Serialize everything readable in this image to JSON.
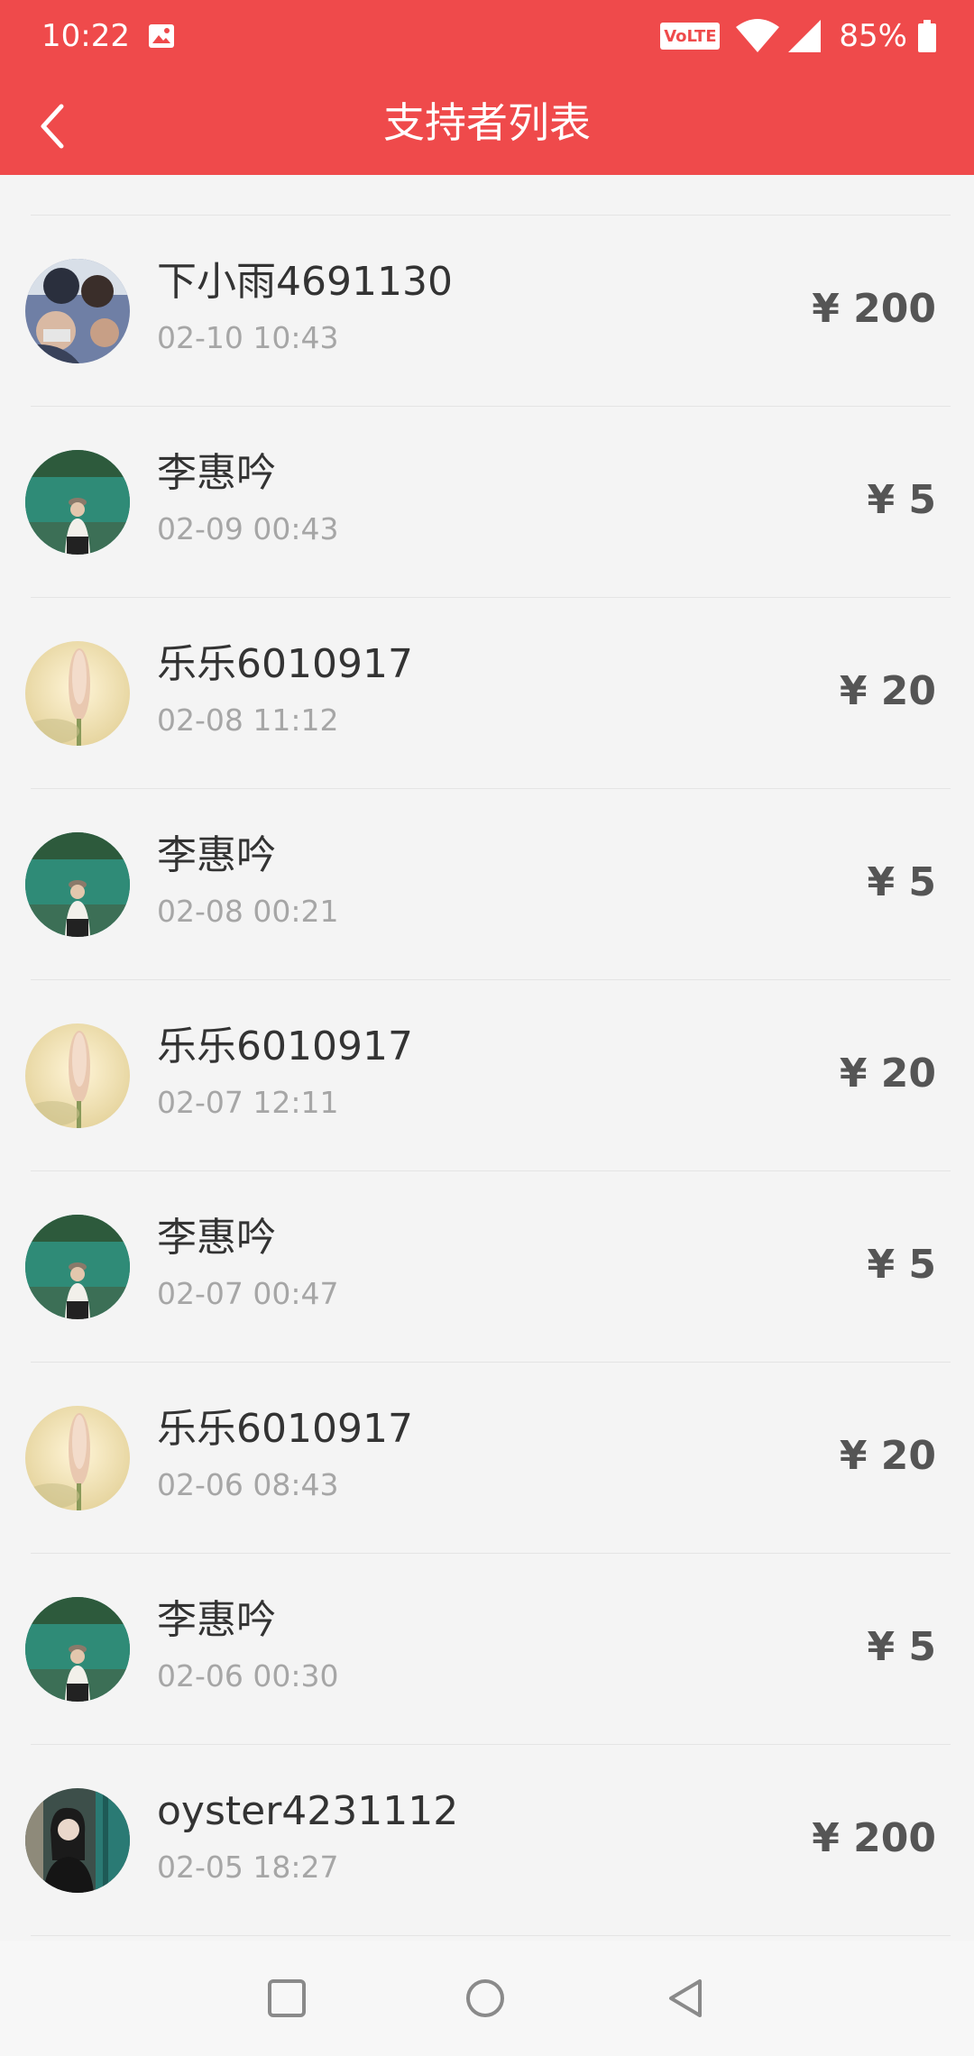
{
  "status_bar": {
    "time": "10:22",
    "network_badge": "VoLTE",
    "battery_percent": "85%",
    "icons": [
      "image-icon",
      "volte-icon",
      "wifi-icon",
      "signal-icon",
      "battery-icon"
    ]
  },
  "header": {
    "title": "支持者列表",
    "back_icon": "chevron-left-icon"
  },
  "colors": {
    "header_bg": "#ef4a4b",
    "page_bg": "#f4f4f4",
    "name_text": "#333333",
    "time_text": "#a6a6a6",
    "amount_text": "#555555"
  },
  "supporters": [
    {
      "name": "下小雨4691130",
      "time": "02-10 10:43",
      "amount": "¥ 200",
      "avatar": "group-photo"
    },
    {
      "name": "李惠吟",
      "time": "02-09 00:43",
      "amount": "¥ 5",
      "avatar": "lake-portrait"
    },
    {
      "name": "乐乐6010917",
      "time": "02-08 11:12",
      "amount": "¥ 20",
      "avatar": "flower-photo"
    },
    {
      "name": "李惠吟",
      "time": "02-08 00:21",
      "amount": "¥ 5",
      "avatar": "lake-portrait"
    },
    {
      "name": "乐乐6010917",
      "time": "02-07 12:11",
      "amount": "¥ 20",
      "avatar": "flower-photo"
    },
    {
      "name": "李惠吟",
      "time": "02-07 00:47",
      "amount": "¥ 5",
      "avatar": "lake-portrait"
    },
    {
      "name": "乐乐6010917",
      "time": "02-06 08:43",
      "amount": "¥ 20",
      "avatar": "flower-photo"
    },
    {
      "name": "李惠吟",
      "time": "02-06 00:30",
      "amount": "¥ 5",
      "avatar": "lake-portrait"
    },
    {
      "name": "oyster4231112",
      "time": "02-05 18:27",
      "amount": "¥ 200",
      "avatar": "dark-portrait"
    }
  ],
  "nav_bar": {
    "buttons": [
      "recents-square-icon",
      "home-circle-icon",
      "back-triangle-icon"
    ]
  }
}
